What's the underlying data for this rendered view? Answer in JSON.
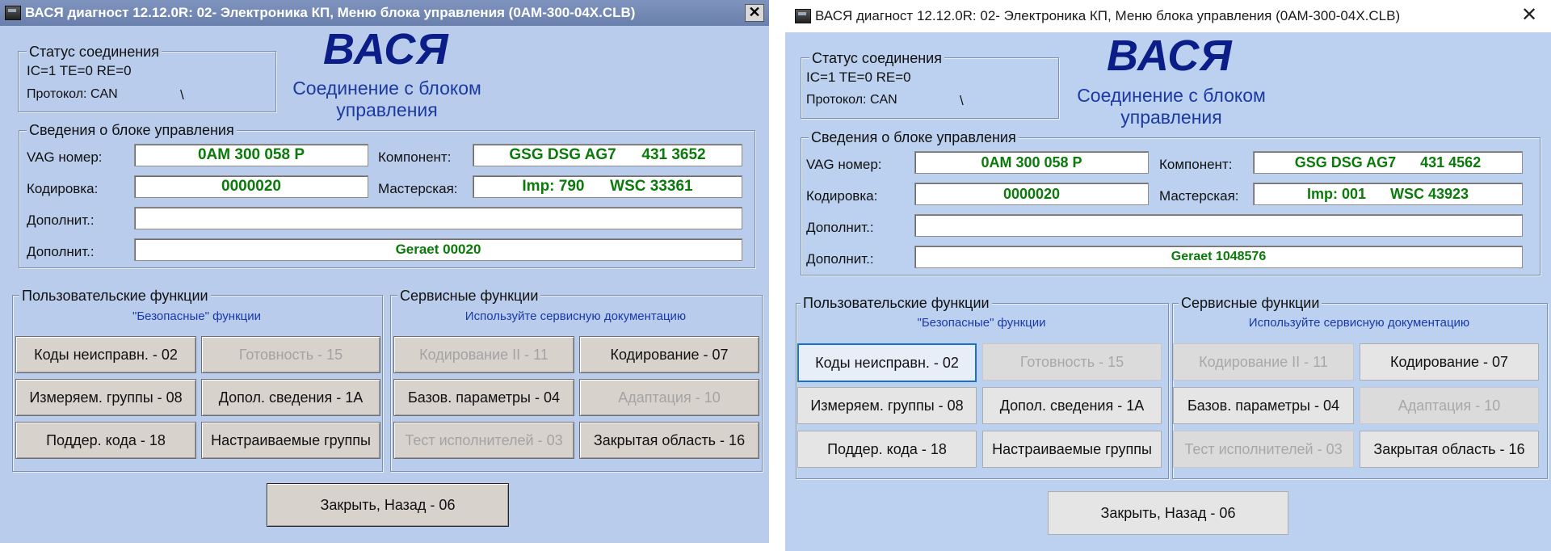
{
  "left": {
    "title": "ВАСЯ диагност 12.12.0R: 02- Электроника КП,  Меню блока управления (0AM-300-04X.CLB)",
    "close_glyph": "✕",
    "status": {
      "group_label": "Статус соединения",
      "line1": "IC=1  TE=0  RE=0",
      "protocol": "Протокол: CAN",
      "spinner": "\\"
    },
    "logo": "ВАСЯ",
    "connection_line1": "Соединение с блоком",
    "connection_line2": "управления",
    "info": {
      "group_label": "Сведения о блоке управления",
      "vag_label": "VAG номер:",
      "vag_value": "0AM 300 058 P",
      "component_label": "Компонент:",
      "component_value": "GSG DSG AG7      431 3652",
      "coding_label": "Кодировка:",
      "coding_value": "0000020",
      "workshop_label": "Мастерская:",
      "workshop_value": "Imp: 790      WSC 33361",
      "extra1_label": "Дополнит.:",
      "extra1_value": "",
      "extra2_label": "Дополнит.:",
      "extra2_value": "Geraet 00020"
    },
    "user_functions": {
      "group_label": "Пользовательские функции",
      "subtitle": "\"Безопасные\" функции",
      "buttons": [
        "Коды неисправн. - 02",
        "Готовность - 15",
        "Измеряем. группы - 08",
        "Допол. сведения - 1А",
        "Поддер. кода - 18",
        "Настраиваемые группы"
      ]
    },
    "service_functions": {
      "group_label": "Сервисные функции",
      "subtitle": "Используйте сервисную документацию",
      "buttons": [
        "Кодирование II - 11",
        "Кодирование - 07",
        "Базов. параметры - 04",
        "Адаптация - 10",
        "Тест исполнителей - 03",
        "Закрытая область - 16"
      ]
    },
    "close_back": "Закрыть, Назад - 06"
  },
  "right": {
    "title": "ВАСЯ диагност 12.12.0R: 02- Электроника КП,  Меню блока управления (0AM-300-04X.CLB)",
    "close_glyph": "✕",
    "status": {
      "group_label": "Статус соединения",
      "line1": "IC=1  TE=0  RE=0",
      "protocol": "Протокол: CAN",
      "spinner": "\\"
    },
    "logo": "ВАСЯ",
    "connection_line1": "Соединение с блоком",
    "connection_line2": "управления",
    "info": {
      "group_label": "Сведения о блоке управления",
      "vag_label": "VAG номер:",
      "vag_value": "0AM 300 058 P",
      "component_label": "Компонент:",
      "component_value": "GSG DSG AG7      431 4562",
      "coding_label": "Кодировка:",
      "coding_value": "0000020",
      "workshop_label": "Мастерская:",
      "workshop_value": "Imp: 001      WSC 43923",
      "extra1_label": "Дополнит.:",
      "extra1_value": "",
      "extra2_label": "Дополнит.:",
      "extra2_value": "Geraet 1048576"
    },
    "user_functions": {
      "group_label": "Пользовательские функции",
      "subtitle": "\"Безопасные\" функции",
      "buttons": [
        "Коды неисправн. - 02",
        "Готовность - 15",
        "Измеряем. группы - 08",
        "Допол. сведения - 1А",
        "Поддер. кода - 18",
        "Настраиваемые группы"
      ]
    },
    "service_functions": {
      "group_label": "Сервисные функции",
      "subtitle": "Используйте сервисную документацию",
      "buttons": [
        "Кодирование II - 11",
        "Кодирование - 07",
        "Базов. параметры - 04",
        "Адаптация - 10",
        "Тест исполнителей - 03",
        "Закрытая область - 16"
      ]
    },
    "close_back": "Закрыть, Назад - 06"
  }
}
